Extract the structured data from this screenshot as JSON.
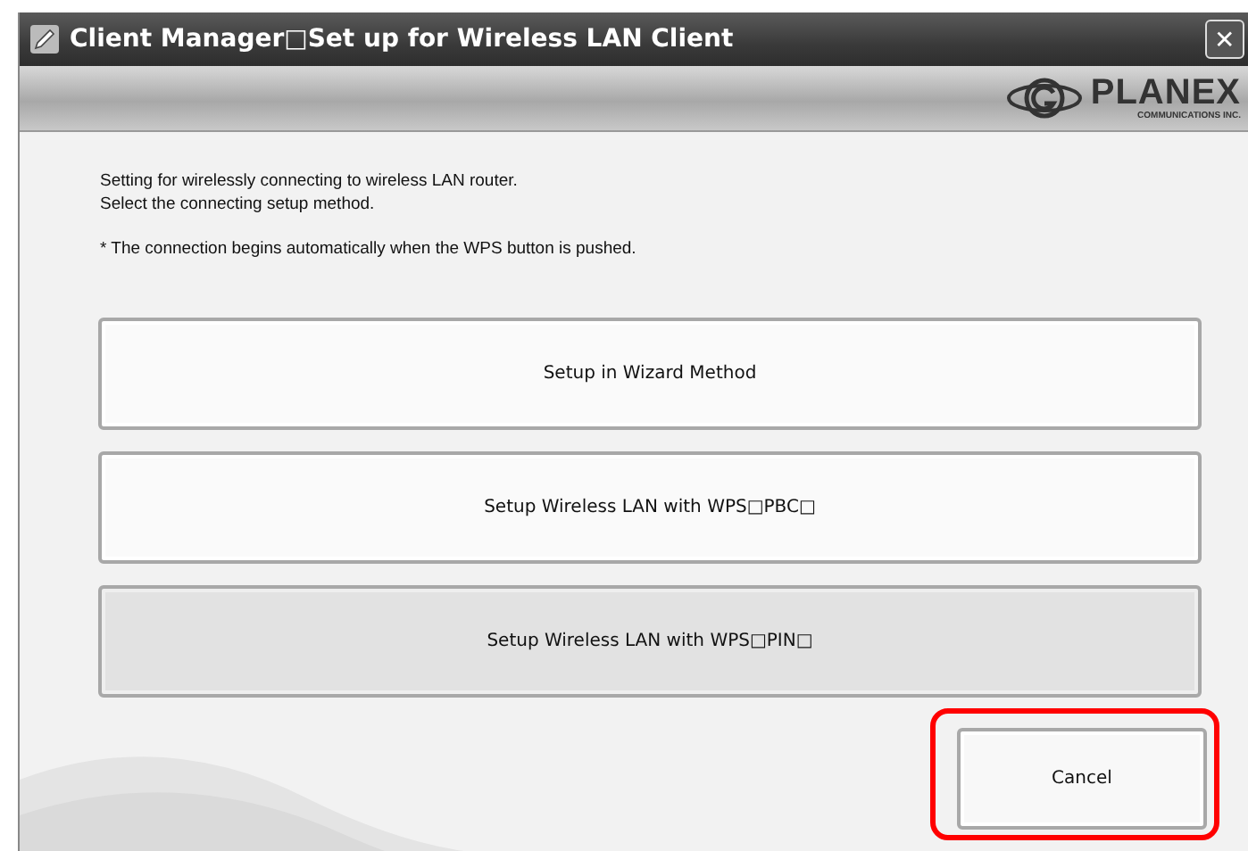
{
  "window": {
    "title": "Client Manager□Set up for Wireless LAN Client",
    "close": "✕"
  },
  "logo": {
    "name": "PLANEX",
    "subtitle": "COMMUNICATIONS INC."
  },
  "instructions": [
    "Setting for wirelessly connecting to wireless LAN router.",
    "Select the connecting setup method."
  ],
  "note": "* The connection begins automatically when the WPS button is pushed.",
  "methods": [
    {
      "label": "Setup in Wizard Method",
      "selected": false
    },
    {
      "label": "Setup Wireless LAN with WPS□PBC□",
      "selected": false
    },
    {
      "label": "Setup Wireless LAN with WPS□PIN□",
      "selected": true
    }
  ],
  "cancel": {
    "label": "Cancel",
    "highlighted": true
  }
}
